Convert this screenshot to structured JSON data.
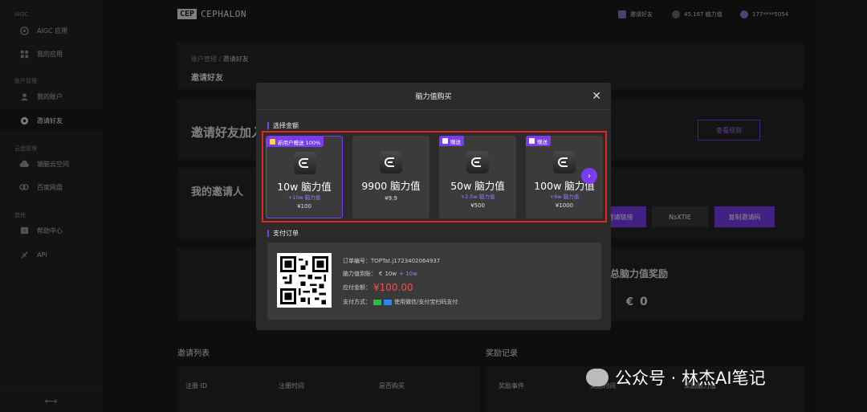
{
  "sidebar": {
    "sections": [
      {
        "label": "AIGC",
        "items": [
          {
            "label": "AIGC 应用",
            "icon": "brain-icon"
          },
          {
            "label": "我的应用",
            "icon": "apps-grid-icon"
          }
        ]
      },
      {
        "label": "账户管理",
        "items": [
          {
            "label": "我的账户",
            "icon": "user-icon"
          },
          {
            "label": "邀请好友",
            "icon": "invite-icon"
          }
        ]
      },
      {
        "label": "云盘管理",
        "items": [
          {
            "label": "端脑云空间",
            "icon": "cloud-icon"
          },
          {
            "label": "百度网盘",
            "icon": "baidu-disk-icon"
          }
        ]
      },
      {
        "label": "其他",
        "items": [
          {
            "label": "帮助中心",
            "icon": "help-icon"
          },
          {
            "label": "API",
            "icon": "api-icon"
          }
        ]
      }
    ]
  },
  "topbar": {
    "logo_box": "CEP",
    "logo_text": "CEPHALON",
    "invite_label": "邀请好友",
    "balance_label": "45,167 脑力值",
    "user_label": "177****5054"
  },
  "page": {
    "breadcrumb_parent": "账户管理",
    "breadcrumb_sep": "/",
    "breadcrumb_current": "邀请好友",
    "title": "邀请好友",
    "banner_text": "邀请好友加入",
    "banner_btn": "查看规则",
    "inviter_title": "我的邀请人",
    "copy_link_btn": "邀请链接",
    "invite_code": "NsXTIE",
    "copy_code_btn": "复制邀请码",
    "reward_title": "总脑力值奖励",
    "reward_value": "0",
    "invite_list_title": "邀请列表",
    "reward_record_title": "奖励记录",
    "invite_table_headers": [
      "注册 ID",
      "注册时间",
      "是否购买"
    ],
    "reward_table_headers": [
      "奖励事件",
      "奖励时间",
      "奖励脑力值"
    ]
  },
  "modal": {
    "title": "脑力值购买",
    "close": "✕",
    "select_label": "选择金额",
    "packages": [
      {
        "badge": "新用户赠送 100%",
        "name": "10w 脑力值",
        "bonus": "+10w 脑力值",
        "price": "¥100",
        "selected": true
      },
      {
        "badge": "",
        "name": "9900 脑力值",
        "bonus": "",
        "price": "¥9.9",
        "selected": false
      },
      {
        "badge": "赠送",
        "name": "50w 脑力值",
        "bonus": "+2.5w 脑力值",
        "price": "¥500",
        "selected": false
      },
      {
        "badge": "赠送",
        "name": "100w 脑力值",
        "bonus": "+8w 脑力值",
        "price": "¥1000",
        "selected": false
      }
    ],
    "pay_label": "支付订单",
    "order_no_label": "订单编号：",
    "order_no": "TOPTat.j1723402064937",
    "receive_label": "脑力值到账：",
    "receive_base": "10w",
    "receive_bonus": "+ 10w",
    "amount_label": "应付金额：",
    "amount": "¥100.00",
    "pay_method_label": "支付方式：",
    "pay_method_text": "使用微信/支付宝扫码支付"
  },
  "watermark": {
    "text": "公众号 · 林杰AI笔记"
  },
  "colors": {
    "accent": "#7a3cf0",
    "highlight": "#e0261f",
    "price": "#ff4b4b"
  }
}
